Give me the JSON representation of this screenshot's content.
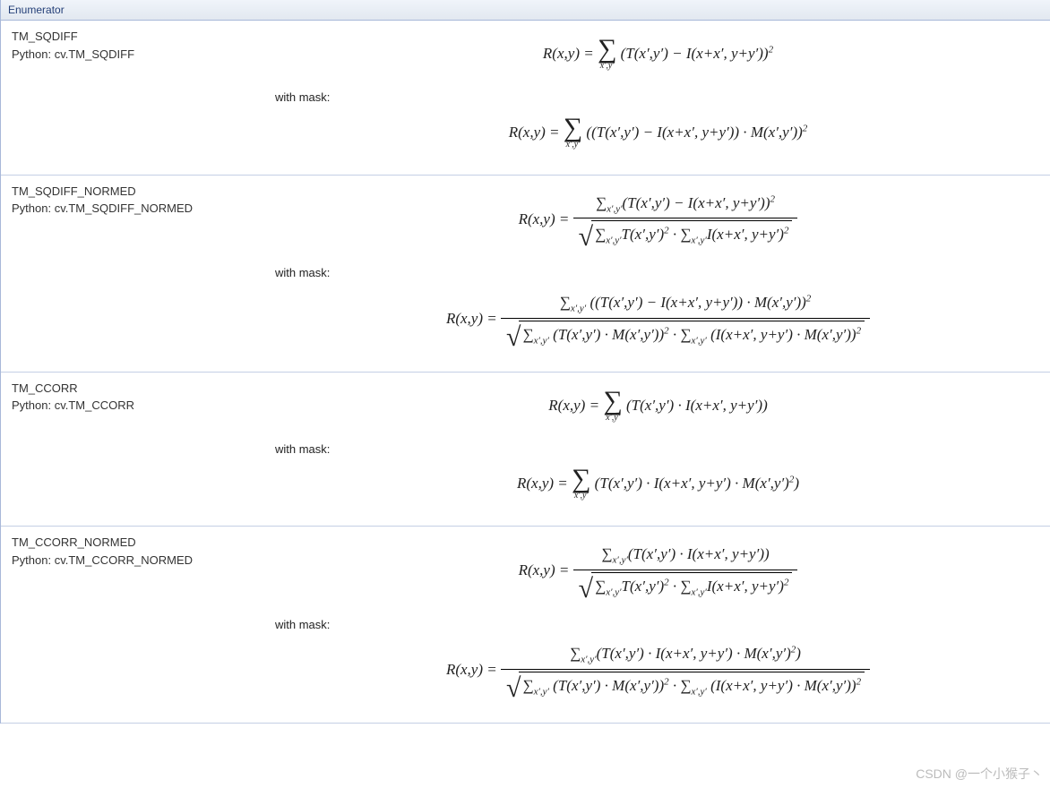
{
  "header": "Enumerator",
  "with_mask_label": "with mask:",
  "watermark": "CSDN @一个小猴子丶",
  "rows": [
    {
      "name": "TM_SQDIFF",
      "python": "Python: cv.TM_SQDIFF",
      "formula_key": "sqdiff",
      "mask_formula_key": "sqdiff_mask"
    },
    {
      "name": "TM_SQDIFF_NORMED",
      "python": "Python: cv.TM_SQDIFF_NORMED",
      "formula_key": "sqdiff_normed",
      "mask_formula_key": "sqdiff_normed_mask"
    },
    {
      "name": "TM_CCORR",
      "python": "Python: cv.TM_CCORR",
      "formula_key": "ccorr",
      "mask_formula_key": "ccorr_mask"
    },
    {
      "name": "TM_CCORR_NORMED",
      "python": "Python: cv.TM_CCORR_NORMED",
      "formula_key": "ccorr_normed",
      "mask_formula_key": "ccorr_normed_mask"
    }
  ],
  "formulas": {
    "sqdiff": "R(x,y) = Σ_{x',y'} (T(x',y') − I(x+x', y+y'))^2",
    "sqdiff_mask": "R(x,y) = Σ_{x',y'} ((T(x',y') − I(x+x', y+y')) · M(x',y'))^2",
    "sqdiff_normed": "R(x,y) = Σ_{x',y'}(T(x',y') − I(x+x', y+y'))^2 / sqrt( Σ_{x',y'} T(x',y')^2 · Σ_{x',y'} I(x+x', y+y')^2 )",
    "sqdiff_normed_mask": "R(x,y) = Σ_{x',y'} ((T(x',y') − I(x+x', y+y')) · M(x',y'))^2 / sqrt( Σ_{x',y'} (T(x',y') · M(x',y'))^2 · Σ_{x',y'} (I(x+x', y+y') · M(x',y'))^2 )",
    "ccorr": "R(x,y) = Σ_{x',y'} (T(x',y') · I(x+x', y+y'))",
    "ccorr_mask": "R(x,y) = Σ_{x',y'} (T(x',y') · I(x+x', y+y') · M(x',y')^2)",
    "ccorr_normed": "R(x,y) = Σ_{x',y'} (T(x',y') · I(x+x', y+y')) / sqrt( Σ_{x',y'} T(x',y')^2 · Σ_{x',y'} I(x+x', y+y')^2 )",
    "ccorr_normed_mask": "R(x,y) = Σ_{x',y'} (T(x',y') · I(x+x', y+y') · M(x',y')^2) / sqrt( Σ_{x',y'} (T(x',y') · M(x',y'))^2 · Σ_{x',y'} (I(x+x', y+y') · M(x',y'))^2 )"
  }
}
